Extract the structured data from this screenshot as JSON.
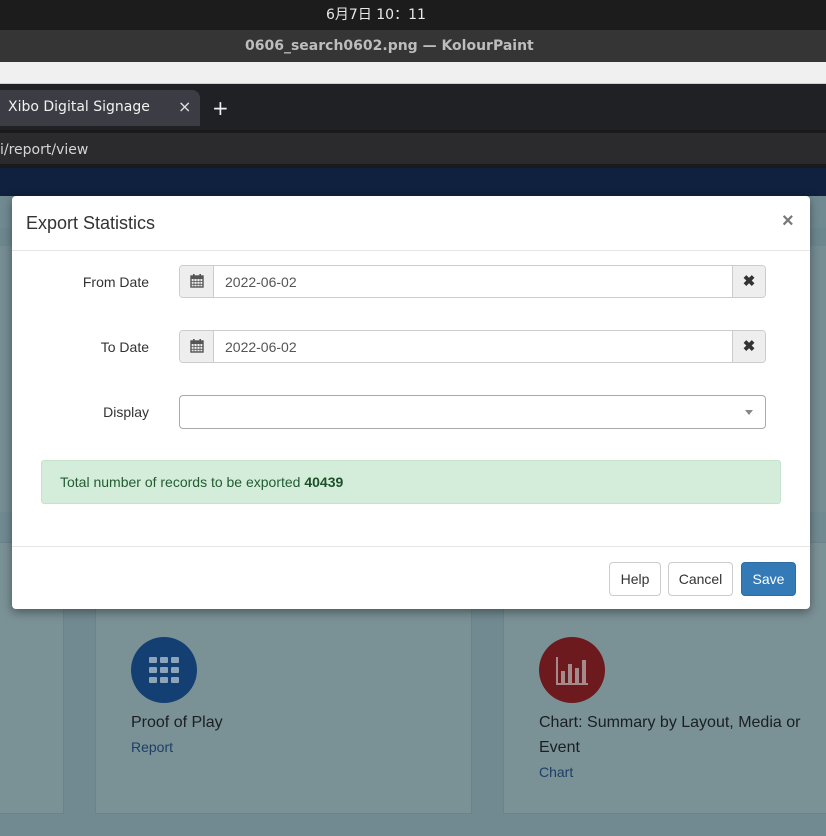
{
  "os": {
    "clock": "6月7日 10：11"
  },
  "window": {
    "title": "0606_search0602.png — KolourPaint"
  },
  "browser": {
    "tab_title": "Xibo Digital Signage",
    "tab_close": "×",
    "new_tab": "+",
    "url": "i/report/view"
  },
  "background_cards": [
    {
      "title": "Proof of Play",
      "link": "Report",
      "icon": "grid-icon",
      "icon_color": "#1b5698"
    },
    {
      "title": "Chart: Summary by Layout, Media or Event",
      "link": "Chart",
      "icon": "bar-chart-icon",
      "icon_color": "#9c2226"
    }
  ],
  "modal": {
    "title": "Export Statistics",
    "close": "×",
    "from_date": {
      "label": "From Date",
      "value": "2022-06-02",
      "icon": "calendar-icon",
      "clear": "✖"
    },
    "to_date": {
      "label": "To Date",
      "value": "2022-06-02",
      "icon": "calendar-icon",
      "clear": "✖"
    },
    "display": {
      "label": "Display",
      "value": ""
    },
    "alert": {
      "text": "Total number of records to be exported",
      "count": "40439"
    },
    "buttons": {
      "help": "Help",
      "cancel": "Cancel",
      "save": "Save"
    }
  },
  "colors": {
    "primary": "#337ab7",
    "success_bg": "#d4eddb",
    "navbar": "#0f213e"
  }
}
